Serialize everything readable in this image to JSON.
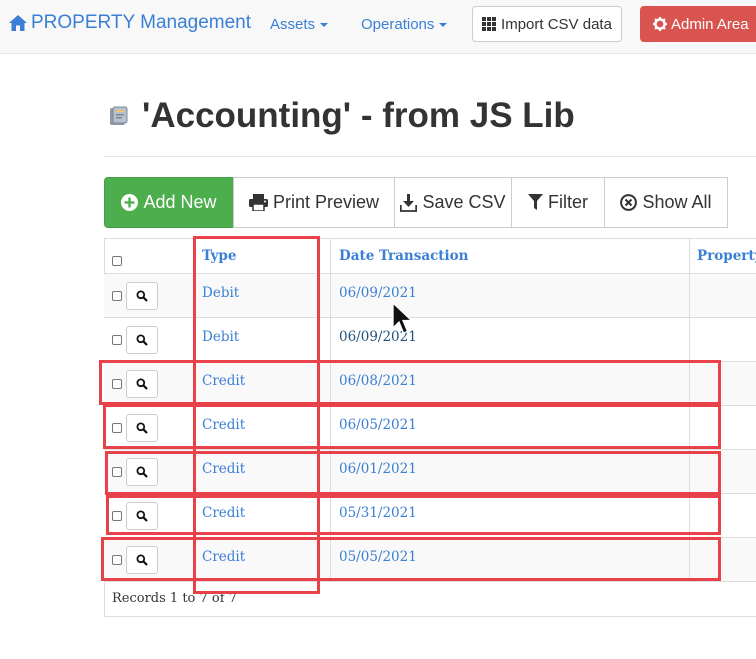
{
  "navbar": {
    "brand": "PROPERTY Management",
    "menus": [
      "Assets",
      "Operations"
    ],
    "import_csv": "Import CSV data",
    "admin_area": "Admin Area"
  },
  "page": {
    "title": "'Accounting' - from JS Lib"
  },
  "toolbar": {
    "add_new": "Add New",
    "print_preview": "Print Preview",
    "save_csv": "Save CSV",
    "filter": "Filter",
    "show_all": "Show All"
  },
  "table": {
    "columns": [
      "Type",
      "Date Transaction",
      "Property"
    ],
    "rows": [
      {
        "type": "Debit",
        "date": "06/09/2021"
      },
      {
        "type": "Debit",
        "date": "06/09/2021"
      },
      {
        "type": "Credit",
        "date": "06/08/2021"
      },
      {
        "type": "Credit",
        "date": "06/05/2021"
      },
      {
        "type": "Credit",
        "date": "06/01/2021"
      },
      {
        "type": "Credit",
        "date": "05/31/2021"
      },
      {
        "type": "Credit",
        "date": "05/05/2021"
      }
    ],
    "records": "Records 1 to 7 of 7"
  },
  "colors": {
    "link": "#3a7fd5",
    "add_new_bg": "#4cae4c",
    "admin_bg": "#d9534f",
    "annotation": "#e8414a"
  },
  "icons": [
    "home-icon",
    "caret-down-icon",
    "grid-icon",
    "cog-icon",
    "book-icon",
    "plus-circle-icon",
    "print-icon",
    "download-icon",
    "filter-icon",
    "times-circle-icon",
    "search-icon",
    "mouse-cursor-icon"
  ]
}
